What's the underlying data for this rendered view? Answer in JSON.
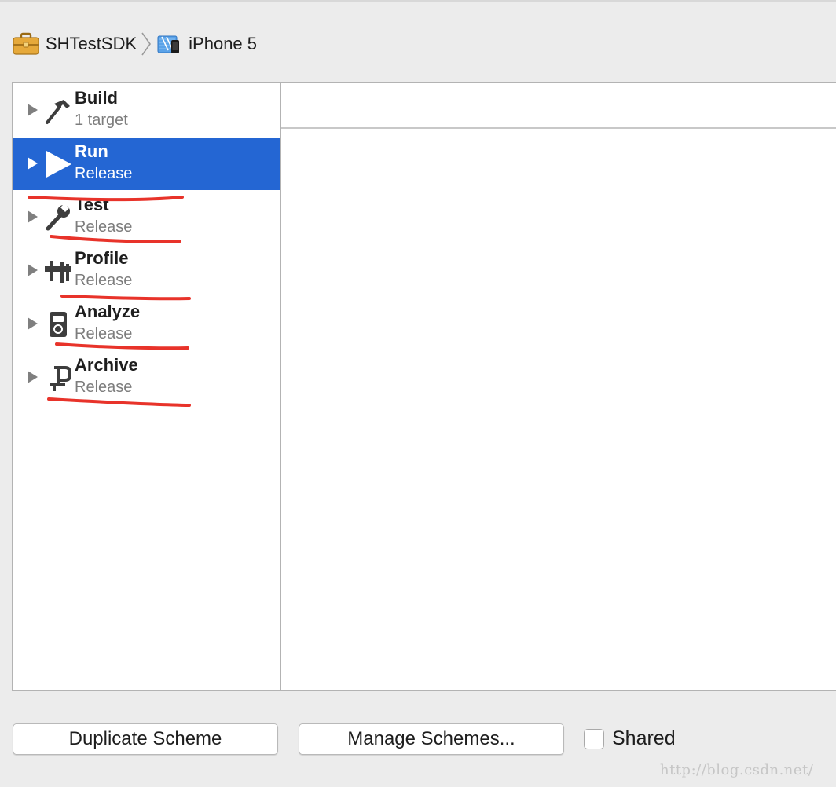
{
  "breadcrumb": {
    "scheme": {
      "label": "SHTestSDK",
      "icon": "toolbox-icon"
    },
    "destination": {
      "label": "iPhone 5",
      "icon": "iphone-device-icon"
    }
  },
  "actions": [
    {
      "title": "Build",
      "subtitle": "1 target",
      "icon": "hammer-icon",
      "selected": false
    },
    {
      "title": "Run",
      "subtitle": "Release",
      "icon": "play-icon",
      "selected": true
    },
    {
      "title": "Test",
      "subtitle": "Release",
      "icon": "wrench-icon",
      "selected": false
    },
    {
      "title": "Profile",
      "subtitle": "Release",
      "icon": "caliper-icon",
      "selected": false
    },
    {
      "title": "Analyze",
      "subtitle": "Release",
      "icon": "multimeter-icon",
      "selected": false
    },
    {
      "title": "Archive",
      "subtitle": "Release",
      "icon": "clamp-icon",
      "selected": false
    }
  ],
  "buttons": {
    "duplicate": "Duplicate Scheme",
    "manage": "Manage Schemes..."
  },
  "shared": {
    "label": "Shared",
    "checked": false
  },
  "watermark": "http://blog.csdn.net/",
  "colors": {
    "selection": "#2466d3",
    "annotation": "#e8332a",
    "background": "#ececec"
  }
}
